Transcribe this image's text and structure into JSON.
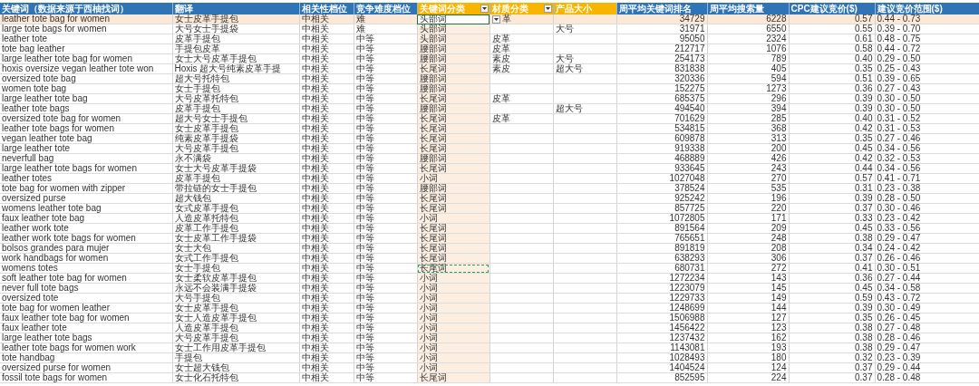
{
  "columns": [
    {
      "label": "关键词（数据来源于西柚找词）",
      "color": "#2f75b5",
      "filter": false,
      "shaded": false
    },
    {
      "label": "翻译",
      "color": "#2f75b5",
      "filter": false,
      "shaded": false
    },
    {
      "label": "相关性档位",
      "color": "#2f75b5",
      "filter": false,
      "shaded": false
    },
    {
      "label": "竞争难度档位",
      "color": "#2f75b5",
      "filter": false,
      "shaded": false
    },
    {
      "label": "关键词分类",
      "color": "#f7b500",
      "filter": true,
      "shaded": true
    },
    {
      "label": "材质分类",
      "color": "#f7b500",
      "filter": true,
      "shaded": false
    },
    {
      "label": "产品大小",
      "color": "#f7b500",
      "filter": false,
      "shaded": false
    },
    {
      "label": "周平均关键词排名",
      "color": "#2f75b5",
      "filter": false,
      "shaded": false
    },
    {
      "label": "周平均搜索量",
      "color": "#2f75b5",
      "filter": false,
      "shaded": false
    },
    {
      "label": "CPC建议竞价($)",
      "color": "#2f75b5",
      "filter": false,
      "shaded": false
    },
    {
      "label": "建议竞价范围($)",
      "color": "#2f75b5",
      "filter": false,
      "shaded": false
    }
  ],
  "rows": [
    {
      "keyword": "leather tote bag for women",
      "translation": "女士皮革手提包",
      "relevance": "中相关",
      "competition": "难",
      "category": "头部词",
      "material": "革",
      "rank": "34729",
      "volume": "6228",
      "cpc": "0.57",
      "bid_range": "0.44 - 0.73",
      "selected": true,
      "copied": false
    },
    {
      "keyword": "large tote bags for women",
      "translation": "大号女士手提袋",
      "relevance": "中相关",
      "competition": "难",
      "category": "头部词",
      "size": "大号",
      "rank": "31971",
      "volume": "6550",
      "cpc": "0.55",
      "bid_range": "0.39 - 0.70",
      "selected": false,
      "copied": false
    },
    {
      "keyword": "leather tote",
      "translation": "皮革手提包",
      "relevance": "中相关",
      "competition": "中等",
      "category": "头部词",
      "material": "皮革",
      "rank": "95050",
      "volume": "2324",
      "cpc": "0.61",
      "bid_range": "0.48 - 0.75",
      "selected": false,
      "copied": false
    },
    {
      "keyword": "tote bag leather",
      "translation": "手提包皮革",
      "relevance": "中相关",
      "competition": "中等",
      "category": "腰部词",
      "material": "皮革",
      "rank": "212717",
      "volume": "1076",
      "cpc": "0.58",
      "bid_range": "0.44 - 0.72",
      "selected": false,
      "copied": false
    },
    {
      "keyword": "large leather tote bag for women",
      "translation": "女士大号皮革手提包",
      "relevance": "中相关",
      "competition": "中等",
      "category": "腰部词",
      "material": "素皮",
      "size": "大号",
      "rank": "254173",
      "volume": "789",
      "cpc": "0.40",
      "bid_range": "0.29 - 0.50",
      "selected": false,
      "copied": false
    },
    {
      "keyword": "hoxis oversize vegan leather tote won",
      "translation": "Hoxis 超大号纯素皮革手提",
      "relevance": "中相关",
      "competition": "中等",
      "category": "长尾词",
      "material": "素皮",
      "size": "超大号",
      "rank": "831838",
      "volume": "405",
      "cpc": "0.35",
      "bid_range": "0.25 - 0.43",
      "selected": false,
      "copied": false
    },
    {
      "keyword": "oversized tote bag",
      "translation": "超大号托特包",
      "relevance": "中相关",
      "competition": "中等",
      "category": "腰部词",
      "rank": "320336",
      "volume": "594",
      "cpc": "0.51",
      "bid_range": "0.39 - 0.65",
      "selected": false,
      "copied": false
    },
    {
      "keyword": "women tote bag",
      "translation": "女士手提包",
      "relevance": "中相关",
      "competition": "中等",
      "category": "腰部词",
      "rank": "152275",
      "volume": "1273",
      "cpc": "0.36",
      "bid_range": "0.27 - 0.43",
      "selected": false,
      "copied": false
    },
    {
      "keyword": "large leather tote bag",
      "translation": "大号皮革托特包",
      "relevance": "中相关",
      "competition": "中等",
      "category": "长尾词",
      "material": "皮革",
      "rank": "685375",
      "volume": "296",
      "cpc": "0.39",
      "bid_range": "0.30 - 0.50",
      "selected": false,
      "copied": false
    },
    {
      "keyword": "leather tote bags",
      "translation": "皮革手提包",
      "relevance": "中相关",
      "competition": "中等",
      "category": "腰部词",
      "size": "超大号",
      "rank": "494540",
      "volume": "394",
      "cpc": "0.39",
      "bid_range": "0.30 - 0.50",
      "selected": false,
      "copied": false
    },
    {
      "keyword": "oversized tote bag for women",
      "translation": "超大号女士手提包",
      "relevance": "中相关",
      "competition": "中等",
      "category": "长尾词",
      "material": "皮革",
      "rank": "701629",
      "volume": "285",
      "cpc": "0.40",
      "bid_range": "0.31 - 0.52",
      "selected": false,
      "copied": false
    },
    {
      "keyword": "leather tote bags for women",
      "translation": "女士皮革手提包",
      "relevance": "中相关",
      "competition": "中等",
      "category": "长尾词",
      "rank": "534815",
      "volume": "368",
      "cpc": "0.42",
      "bid_range": "0.31 - 0.53",
      "selected": false,
      "copied": false
    },
    {
      "keyword": "vegan leather tote bag",
      "translation": "纯素皮革手提袋",
      "relevance": "中相关",
      "competition": "中等",
      "category": "长尾词",
      "rank": "609878",
      "volume": "313",
      "cpc": "0.35",
      "bid_range": "0.27 - 0.46",
      "selected": false,
      "copied": false
    },
    {
      "keyword": "large leather tote",
      "translation": "大号皮革手提包",
      "relevance": "中相关",
      "competition": "中等",
      "category": "长尾词",
      "rank": "919338",
      "volume": "200",
      "cpc": "0.45",
      "bid_range": "0.34 - 0.56",
      "selected": false,
      "copied": false
    },
    {
      "keyword": "neverfull bag",
      "translation": "永不满袋",
      "relevance": "中相关",
      "competition": "中等",
      "category": "腰部词",
      "rank": "468889",
      "volume": "426",
      "cpc": "0.42",
      "bid_range": "0.32 - 0.53",
      "selected": false,
      "copied": false
    },
    {
      "keyword": "large leather tote bags for women",
      "translation": "女士大号皮革手提袋",
      "relevance": "中相关",
      "competition": "中等",
      "category": "长尾词",
      "rank": "933645",
      "volume": "243",
      "cpc": "0.44",
      "bid_range": "0.34 - 0.56",
      "selected": false,
      "copied": false
    },
    {
      "keyword": "leather totes",
      "translation": "皮革手提包",
      "relevance": "中相关",
      "competition": "中等",
      "category": "小词",
      "rank": "1027048",
      "volume": "270",
      "cpc": "0.57",
      "bid_range": "0.41 - 0.71",
      "selected": false,
      "copied": false
    },
    {
      "keyword": "tote bag for women with zipper",
      "translation": "带拉链的女士手提包",
      "relevance": "中相关",
      "competition": "中等",
      "category": "腰部词",
      "rank": "378524",
      "volume": "535",
      "cpc": "0.31",
      "bid_range": "0.23 - 0.38",
      "selected": false,
      "copied": false
    },
    {
      "keyword": "oversized purse",
      "translation": "超大钱包",
      "relevance": "中相关",
      "competition": "中等",
      "category": "长尾词",
      "rank": "925242",
      "volume": "196",
      "cpc": "0.39",
      "bid_range": "0.28 - 0.50",
      "selected": false,
      "copied": false
    },
    {
      "keyword": "womens leather tote bag",
      "translation": "女式皮革手提包",
      "relevance": "中相关",
      "competition": "中等",
      "category": "长尾词",
      "rank": "857725",
      "volume": "220",
      "cpc": "0.37",
      "bid_range": "0.30 - 0.46",
      "selected": false,
      "copied": false
    },
    {
      "keyword": "faux leather tote bag",
      "translation": "人造皮革托特包",
      "relevance": "中相关",
      "competition": "中等",
      "category": "小词",
      "rank": "1072805",
      "volume": "171",
      "cpc": "0.33",
      "bid_range": "0.23 - 0.42",
      "selected": false,
      "copied": false
    },
    {
      "keyword": "leather work tote",
      "translation": "皮革工作手提包",
      "relevance": "中相关",
      "competition": "中等",
      "category": "长尾词",
      "rank": "891564",
      "volume": "209",
      "cpc": "0.45",
      "bid_range": "0.33 - 0.56",
      "selected": false,
      "copied": false
    },
    {
      "keyword": "leather work tote bags for women",
      "translation": "女士皮革工作手提袋",
      "relevance": "中相关",
      "competition": "中等",
      "category": "长尾词",
      "rank": "765651",
      "volume": "248",
      "cpc": "0.38",
      "bid_range": "0.29 - 0.47",
      "selected": false,
      "copied": false
    },
    {
      "keyword": "bolsos grandes para mujer",
      "translation": "女士大包",
      "relevance": "中相关",
      "competition": "中等",
      "category": "长尾词",
      "rank": "891819",
      "volume": "208",
      "cpc": "0.34",
      "bid_range": "0.24 - 0.42",
      "selected": false,
      "copied": false
    },
    {
      "keyword": "work handbags for women",
      "translation": "女式工作手提包",
      "relevance": "中相关",
      "competition": "中等",
      "category": "长尾词",
      "rank": "638293",
      "volume": "306",
      "cpc": "0.37",
      "bid_range": "0.26 - 0.46",
      "selected": false,
      "copied": false
    },
    {
      "keyword": "womens totes",
      "translation": "女士手提包",
      "relevance": "中相关",
      "competition": "中等",
      "category": "长尾词",
      "rank": "680731",
      "volume": "272",
      "cpc": "0.41",
      "bid_range": "0.30 - 0.51",
      "selected": false,
      "copied": true
    },
    {
      "keyword": "soft leather tote bag for women",
      "translation": "女士柔软皮革手提包",
      "relevance": "中相关",
      "competition": "中等",
      "category": "小词",
      "rank": "1272234",
      "volume": "143",
      "cpc": "0.36",
      "bid_range": "0.27 - 0.44",
      "selected": false,
      "copied": false
    },
    {
      "keyword": "never full tote bags",
      "translation": "永远不会装满手提袋",
      "relevance": "中相关",
      "competition": "中等",
      "category": "小词",
      "rank": "1223079",
      "volume": "145",
      "cpc": "0.45",
      "bid_range": "0.34 - 0.58",
      "selected": false,
      "copied": false
    },
    {
      "keyword": "oversized tote",
      "translation": "大号手提包",
      "relevance": "中相关",
      "competition": "中等",
      "category": "小词",
      "rank": "1229733",
      "volume": "149",
      "cpc": "0.59",
      "bid_range": "0.43 - 0.72",
      "selected": false,
      "copied": false
    },
    {
      "keyword": "tote bag for women leather",
      "translation": "女士皮革手提包",
      "relevance": "中相关",
      "competition": "中等",
      "category": "小词",
      "rank": "1248699",
      "volume": "144",
      "cpc": "0.39",
      "bid_range": "0.30 - 0.49",
      "selected": false,
      "copied": false
    },
    {
      "keyword": "faux leather tote bag for women",
      "translation": "女士人造皮革手提包",
      "relevance": "中相关",
      "competition": "中等",
      "category": "小词",
      "rank": "1506988",
      "volume": "127",
      "cpc": "0.35",
      "bid_range": "0.26 - 0.45",
      "selected": false,
      "copied": false
    },
    {
      "keyword": "faux leather tote",
      "translation": "人造皮革手提包",
      "relevance": "中相关",
      "competition": "中等",
      "category": "小词",
      "rank": "1456422",
      "volume": "123",
      "cpc": "0.38",
      "bid_range": "0.27 - 0.48",
      "selected": false,
      "copied": false
    },
    {
      "keyword": "large leather tote bags",
      "translation": "大号皮革手提包",
      "relevance": "中相关",
      "competition": "中等",
      "category": "小词",
      "rank": "1237432",
      "volume": "162",
      "cpc": "0.38",
      "bid_range": "0.28 - 0.46",
      "selected": false,
      "copied": false
    },
    {
      "keyword": "leather tote bags for women work",
      "translation": "女士工作用皮革手提包",
      "relevance": "中相关",
      "competition": "中等",
      "category": "小词",
      "rank": "1143081",
      "volume": "193",
      "cpc": "0.38",
      "bid_range": "0.29 - 0.47",
      "selected": false,
      "copied": false
    },
    {
      "keyword": "tote handbag",
      "translation": "手提包",
      "relevance": "中相关",
      "competition": "中等",
      "category": "小词",
      "rank": "1028493",
      "volume": "180",
      "cpc": "0.32",
      "bid_range": "0.23 - 0.39",
      "selected": false,
      "copied": false
    },
    {
      "keyword": "oversized purse for women",
      "translation": "女士超大钱包",
      "relevance": "中相关",
      "competition": "中等",
      "category": "小词",
      "rank": "1404524",
      "volume": "124",
      "cpc": "0.37",
      "bid_range": "0.29 - 0.44",
      "selected": false,
      "copied": false
    },
    {
      "keyword": "fossil tote bags for women",
      "translation": "女士化石托特包",
      "relevance": "中相关",
      "competition": "中等",
      "category": "长尾词",
      "rank": "852595",
      "volume": "224",
      "cpc": "0.37",
      "bid_range": "0.28 - 0.48",
      "selected": false,
      "copied": false
    }
  ]
}
